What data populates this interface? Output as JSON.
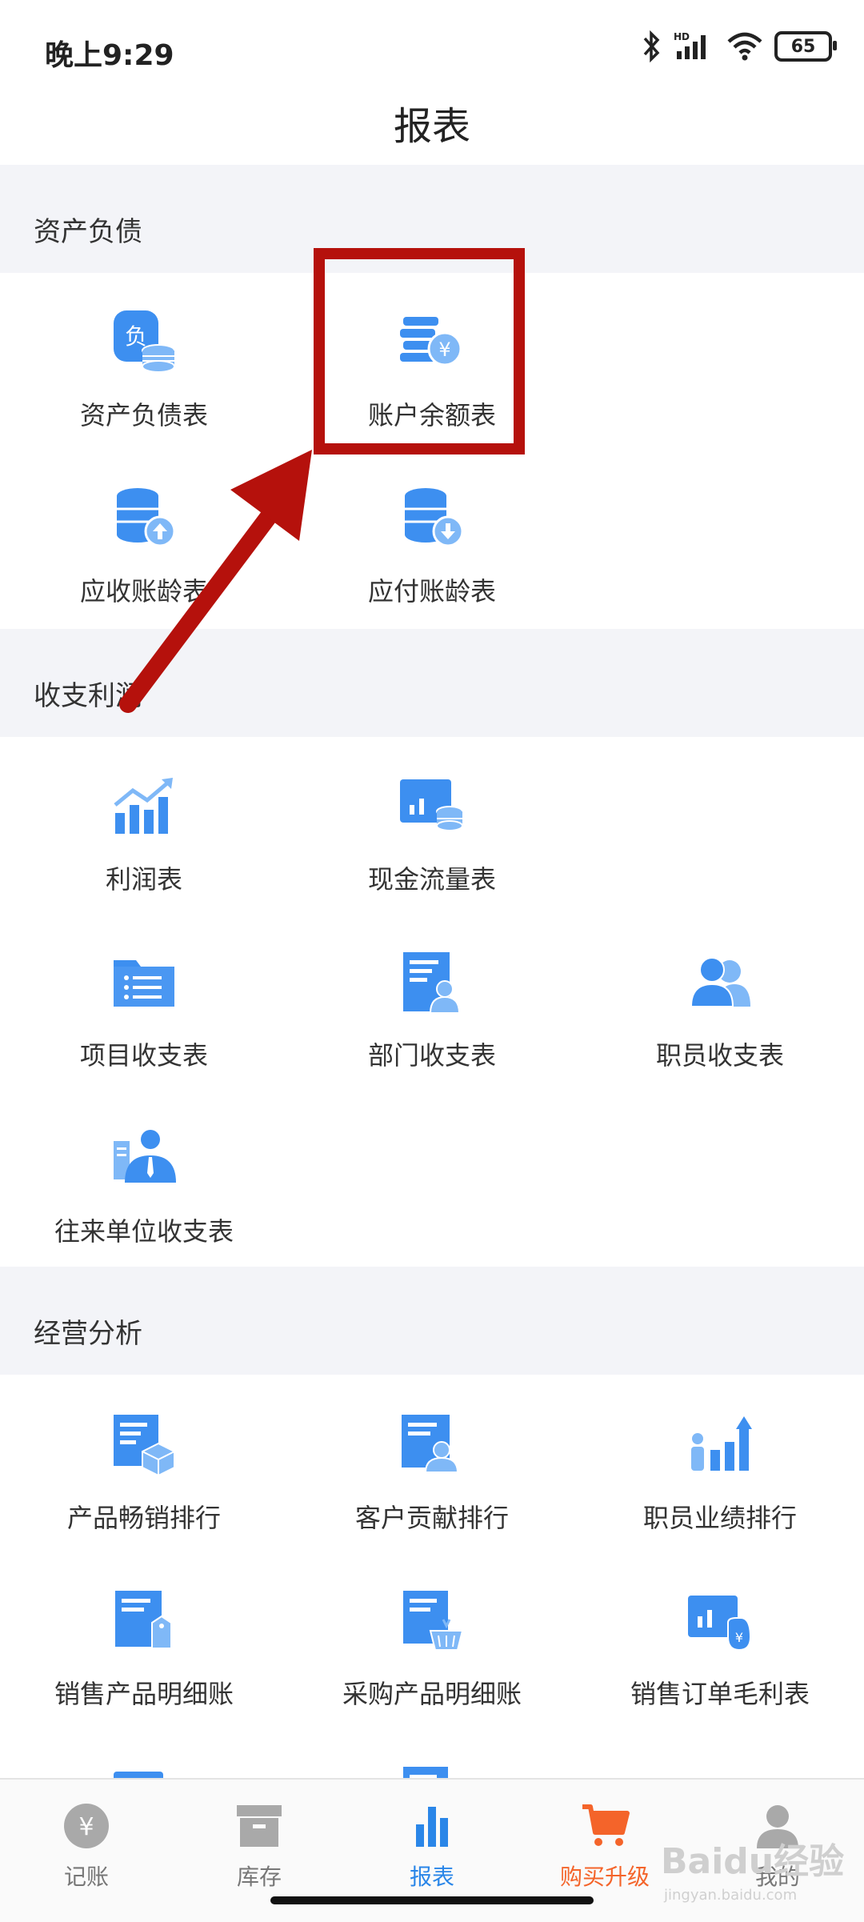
{
  "status_bar": {
    "time": "晚上9:29",
    "battery": "65",
    "network": "HD"
  },
  "header": {
    "title": "报表"
  },
  "sections": [
    {
      "title": "资产负债",
      "items": [
        {
          "label": "资产负债表",
          "icon": "liability-coins-icon"
        },
        {
          "label": "账户余额表",
          "icon": "balance-yuan-icon"
        },
        {
          "label": "应收账龄表",
          "icon": "receivable-up-icon"
        },
        {
          "label": "应付账龄表",
          "icon": "payable-down-icon"
        }
      ]
    },
    {
      "title": "收支利润",
      "items": [
        {
          "label": "利润表",
          "icon": "profit-chart-icon"
        },
        {
          "label": "现金流量表",
          "icon": "cashflow-icon"
        },
        {
          "label": "项目收支表",
          "icon": "project-folder-icon"
        },
        {
          "label": "部门收支表",
          "icon": "department-doc-icon"
        },
        {
          "label": "职员收支表",
          "icon": "staff-users-icon"
        },
        {
          "label": "往来单位收支表",
          "icon": "partner-person-icon"
        }
      ]
    },
    {
      "title": "经营分析",
      "items": [
        {
          "label": "产品畅销排行",
          "icon": "product-box-icon"
        },
        {
          "label": "客户贡献排行",
          "icon": "customer-doc-icon"
        },
        {
          "label": "职员业绩排行",
          "icon": "staff-performance-icon"
        },
        {
          "label": "销售产品明细账",
          "icon": "sales-tag-icon"
        },
        {
          "label": "采购产品明细账",
          "icon": "purchase-basket-icon"
        },
        {
          "label": "销售订单毛利表",
          "icon": "gross-profit-icon"
        }
      ]
    }
  ],
  "tabs": [
    {
      "label": "记账",
      "icon": "yuan-circle-icon"
    },
    {
      "label": "库存",
      "icon": "inventory-box-icon"
    },
    {
      "label": "报表",
      "icon": "report-bars-icon"
    },
    {
      "label": "购买升级",
      "icon": "cart-icon"
    },
    {
      "label": "我的",
      "icon": "user-icon"
    }
  ],
  "colors": {
    "accent": "#2a86e8",
    "icon_blue": "#3d8ff0",
    "upgrade": "#f4642a",
    "highlight": "#b5110c"
  },
  "watermark": {
    "text": "Baidu经验",
    "url": "jingyan.baidu.com"
  }
}
